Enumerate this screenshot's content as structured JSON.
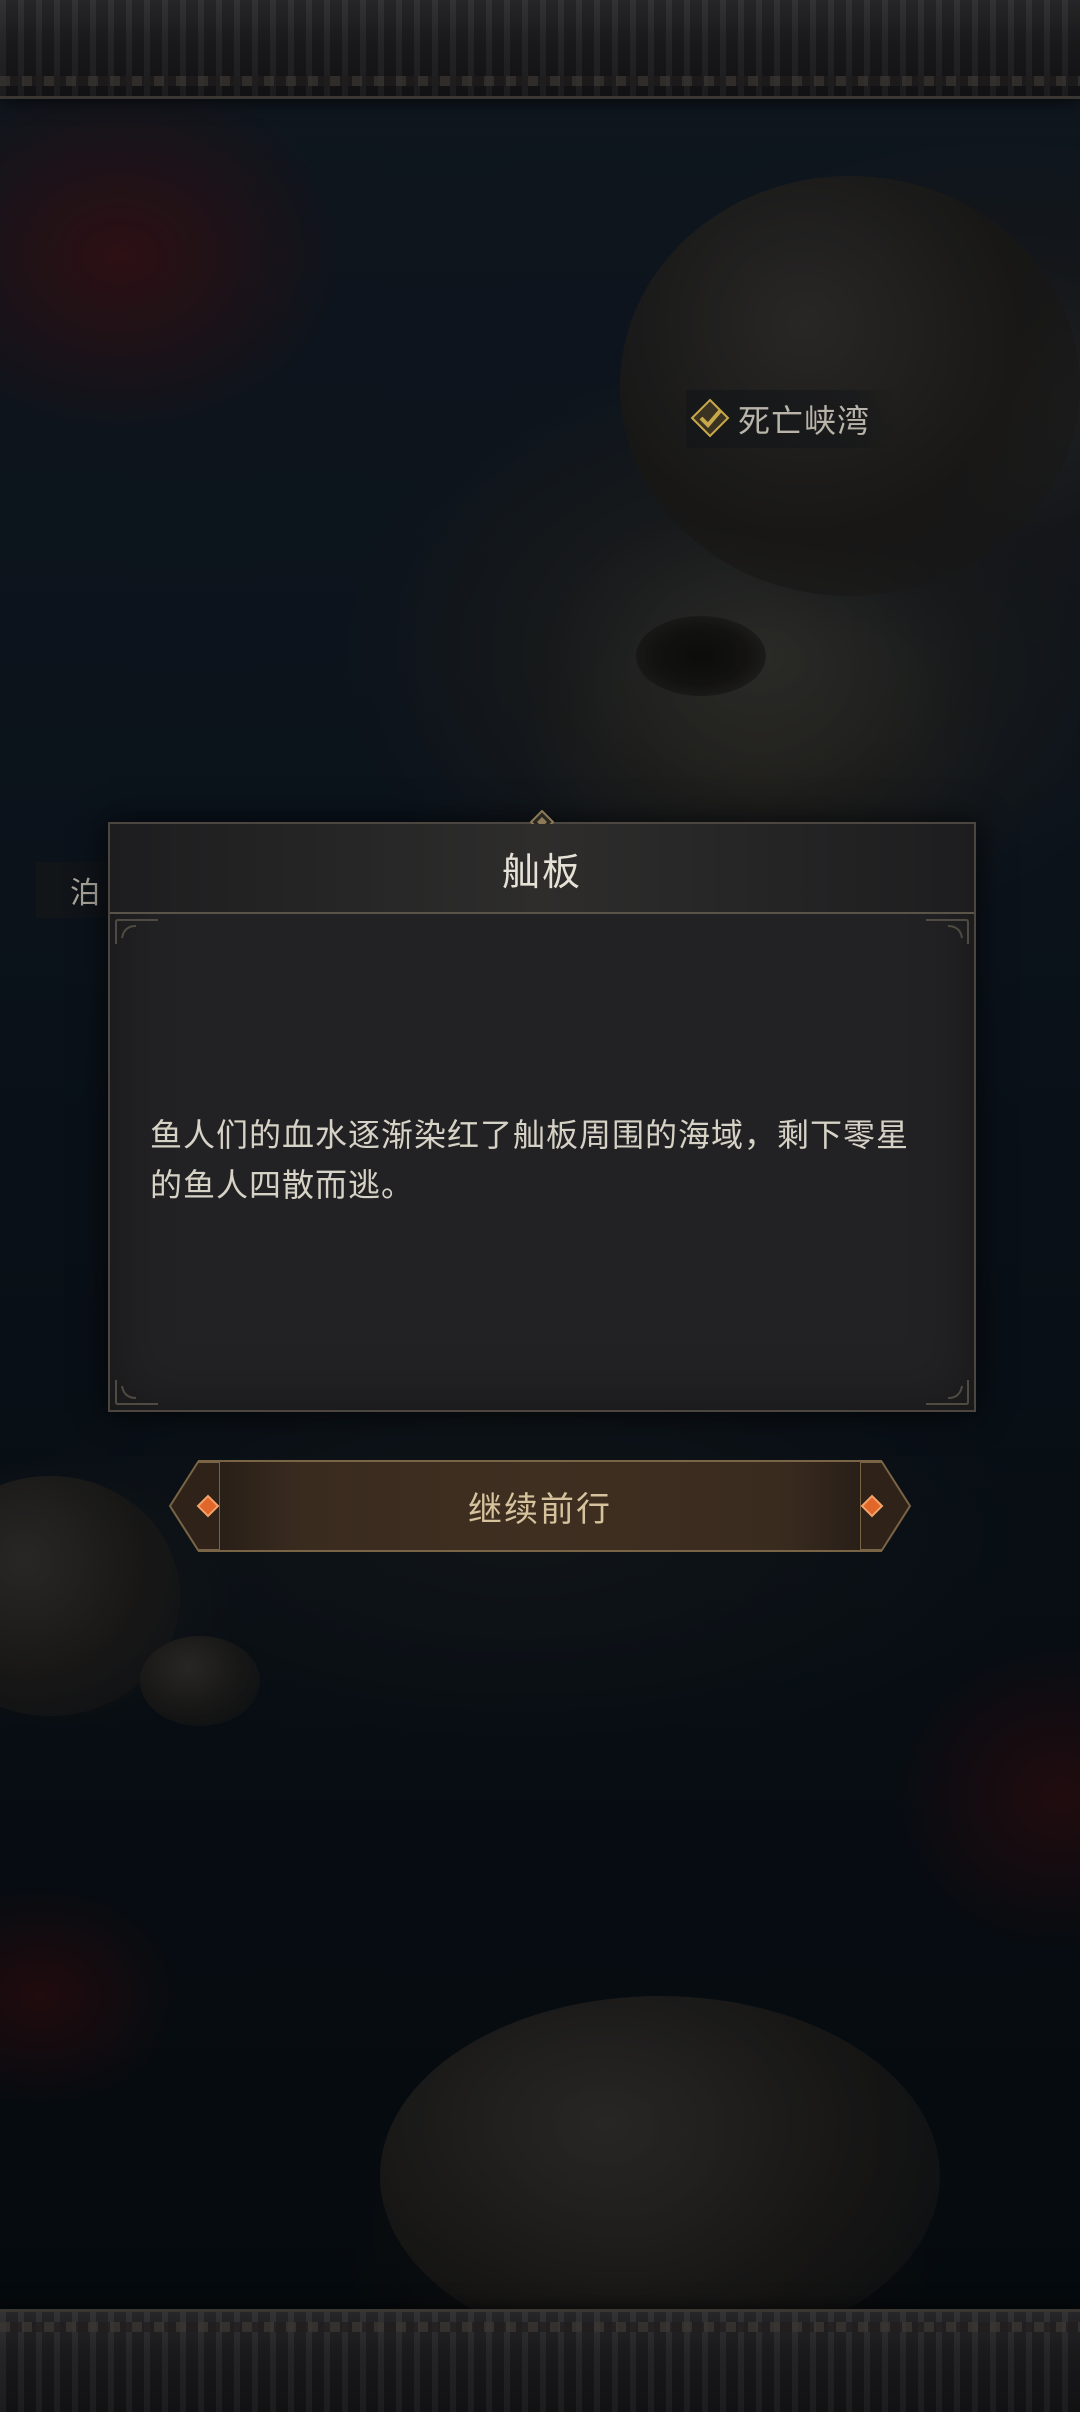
{
  "map": {
    "location_label": "死亡峡湾",
    "left_label": "泊"
  },
  "dialog": {
    "title": "舢板",
    "body": "鱼人们的血水逐渐染红了舢板周围的海域，剩下零星的鱼人四散而逃。"
  },
  "actions": {
    "continue_label": "继续前行"
  },
  "colors": {
    "accent_gold": "#d6c29c",
    "gem_orange": "#e0662a",
    "check_gold": "#c9a84a"
  }
}
